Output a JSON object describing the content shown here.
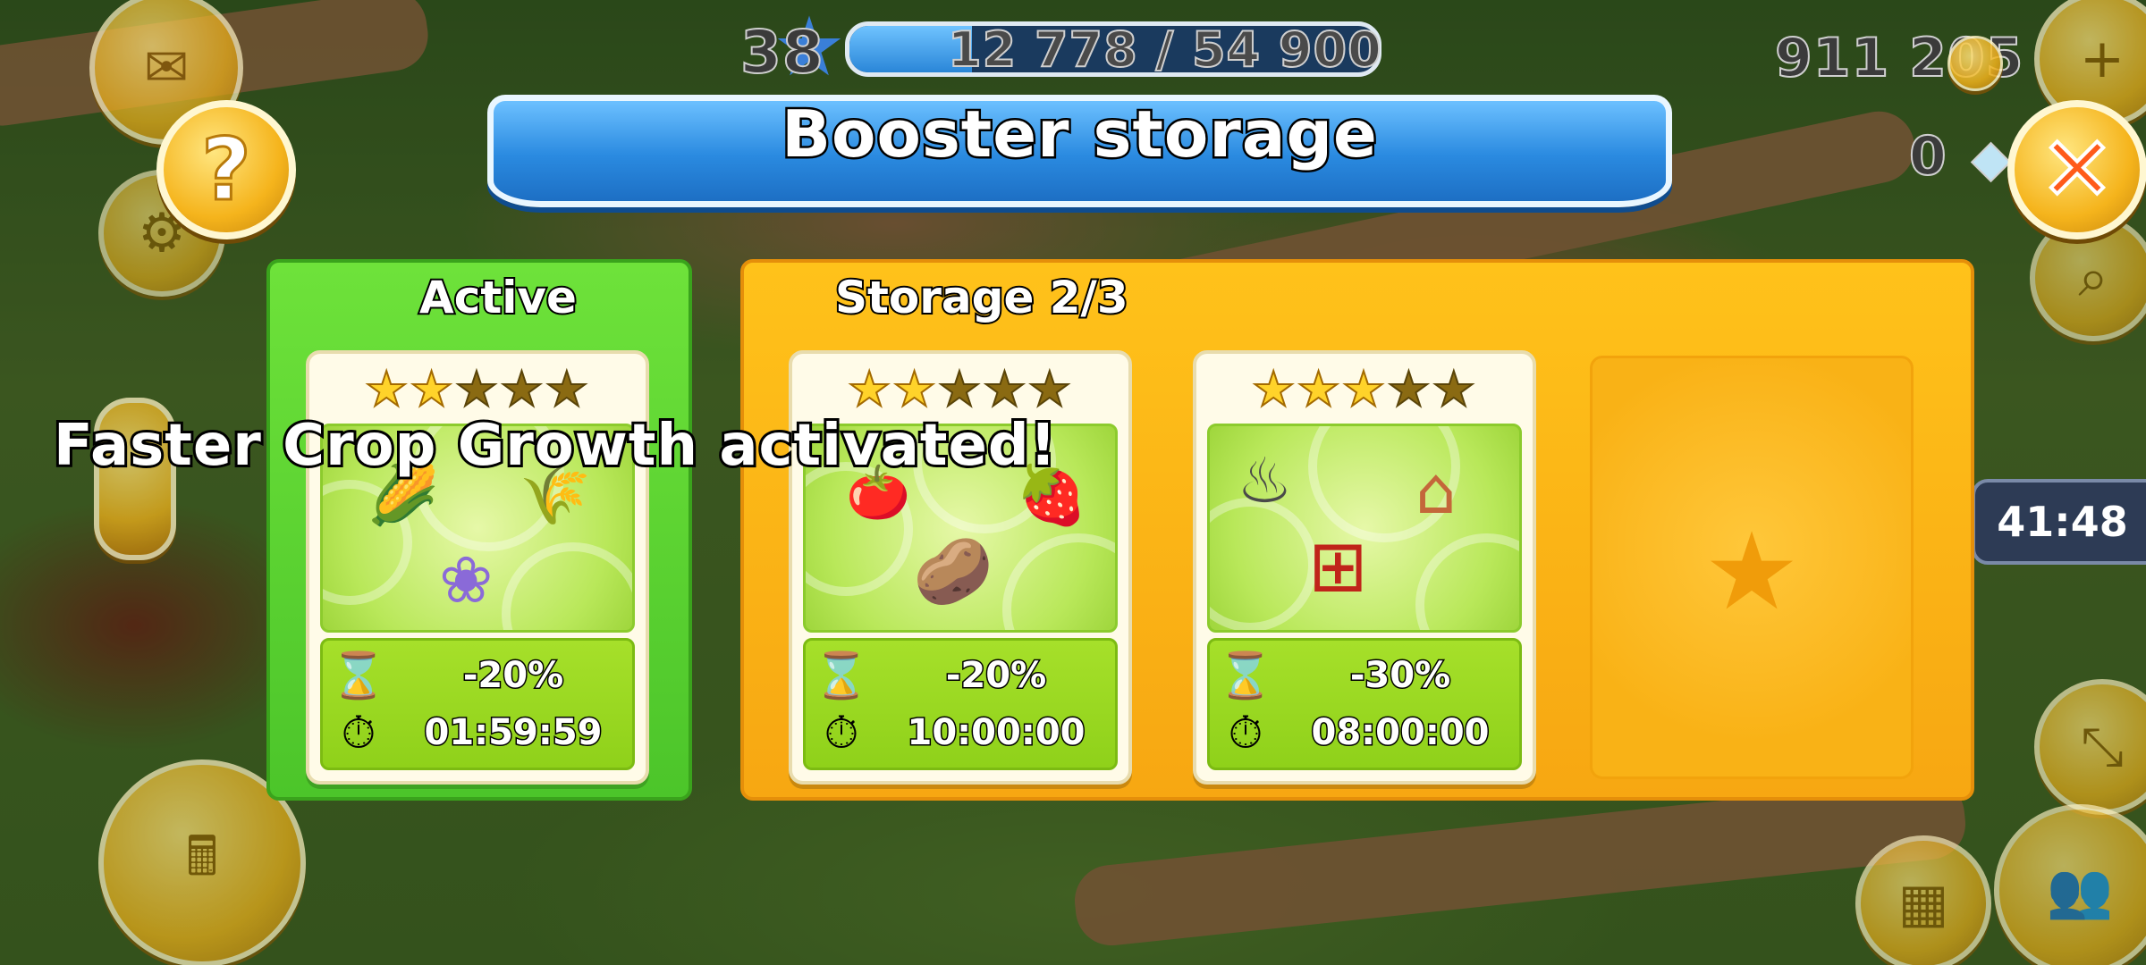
{
  "hud": {
    "level": "38",
    "xp_text": "12 778 / 54 900",
    "xp_progress": 0.233,
    "coins": "911 205",
    "diamonds": "0",
    "timer_badge": "41:48"
  },
  "dialog": {
    "title": "Booster storage",
    "active_label": "Active",
    "storage_label": "Storage 2/3"
  },
  "boosters": [
    {
      "stars": 2,
      "effect": "-20%",
      "time": "01:59:59",
      "items": [
        "lavender",
        "corn",
        "wheat"
      ]
    },
    {
      "stars": 2,
      "effect": "-20%",
      "time": "10:00:00",
      "items": [
        "tomato",
        "strawberry",
        "potato"
      ]
    },
    {
      "stars": 3,
      "effect": "-30%",
      "time": "08:00:00",
      "items": [
        "stove",
        "loom",
        "kiln"
      ]
    }
  ],
  "toast": "Faster Crop Growth activated!",
  "icons": {
    "help": "question-mark",
    "close": "x-mark",
    "effect": "hourglass",
    "timer": "stopwatch",
    "empty": "star"
  },
  "colors": {
    "active_panel": "#5bd231",
    "storage_panel": "#fbb517",
    "ribbon": "#2a8ae0",
    "close_x": "#ff5a1a"
  }
}
